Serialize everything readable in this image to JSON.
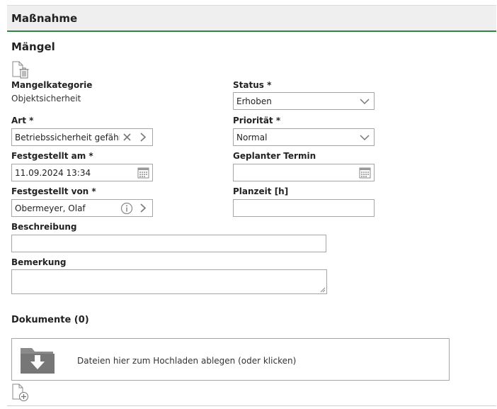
{
  "header": {
    "title": "Maßnahme"
  },
  "section": {
    "title": "Mängel"
  },
  "fields": {
    "mangelkategorie": {
      "label": "Mangelkategorie",
      "value": "Objektsicherheit"
    },
    "status": {
      "label": "Status *",
      "value": "Erhoben"
    },
    "art": {
      "label": "Art *",
      "value": "Betriebssicherheit gefährde"
    },
    "prioritaet": {
      "label": "Priorität *",
      "value": "Normal"
    },
    "festgestellt_am": {
      "label": "Festgestellt am *",
      "value": "11.09.2024 13:34"
    },
    "geplanter_termin": {
      "label": "Geplanter Termin",
      "value": ""
    },
    "festgestellt_von": {
      "label": "Festgestellt von *",
      "value": "Obermeyer, Olaf"
    },
    "planzeit": {
      "label": "Planzeit [h]",
      "value": ""
    },
    "beschreibung": {
      "label": "Beschreibung",
      "value": ""
    },
    "bemerkung": {
      "label": "Bemerkung",
      "value": ""
    }
  },
  "documents": {
    "title": "Dokumente (0)",
    "drop_text": "Dateien hier zum Hochladen ablegen (oder klicken)"
  },
  "colors": {
    "accent": "#2e8540",
    "border": "#a6a6a6",
    "icon": "#808080"
  }
}
